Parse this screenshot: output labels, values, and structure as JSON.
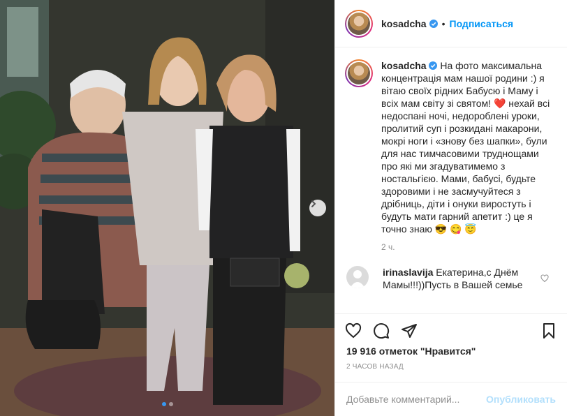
{
  "post": {
    "username": "kosadcha",
    "separator": "•",
    "follow_label": "Подписаться",
    "caption_username": "kosadcha",
    "caption_text": "На фото максимальна концентрація мам нашої родини :) я вітаю своїх рідних Бабусю і Маму і всіх мам світу зі святом! ❤️ нехай всі недоспані ночі, недороблені уроки, пролитий суп і розкидані макарони, мокрі ноги і «знову без шапки», були для нас тимчасовими труднощами про які ми згадуватимемо з ностальгією. Мами, бабусі, будьте здоровими і не засмучуйтеся з дрібниць, діти і онуки виростуть і будуть мати гарний апетит :) це я точно знаю 😎 😋 😇",
    "caption_time": "2 ч.",
    "likes": "19 916 отметок \"Нравится\"",
    "post_time": "2 ЧАСОВ НАЗАД"
  },
  "comment": {
    "username": "irinaslavija",
    "text": "Екатерина,с Днём Мамы!!!))Пусть в Вашей семье"
  },
  "add_comment": {
    "placeholder": "Добавьте комментарий...",
    "publish_label": "Опубликовать"
  },
  "colors": {
    "accent": "#0095f6",
    "verified": "#3897f0",
    "publish_disabled": "#b2dffc"
  },
  "icons": [
    "verified-icon",
    "heart-icon",
    "comment-icon",
    "share-icon",
    "bookmark-icon",
    "chevron-right-icon"
  ]
}
